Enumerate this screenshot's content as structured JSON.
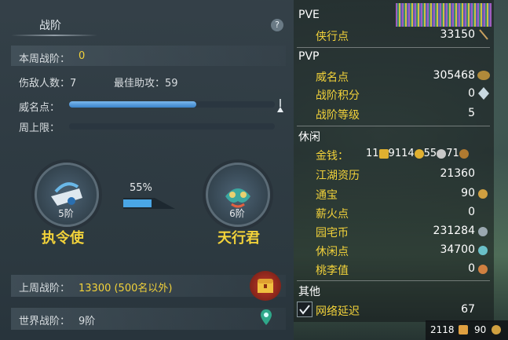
{
  "rank_panel": {
    "title": "战阶",
    "help": "?",
    "weekly_label": "本周战阶：",
    "weekly_value": "0",
    "injured_label": "伤敌人数：",
    "injured_value": "7",
    "best_assist_label": "最佳助攻：",
    "best_assist_value": "59",
    "reputation_label": "威名点：",
    "reputation_fill": 0.62,
    "weekly_cap_label": "周上限：",
    "weekly_cap_fill": 0,
    "progress_percent": "55%",
    "progress_fill": 0.55,
    "current_tier": "5阶",
    "current_name": "执令使",
    "next_tier": "6阶",
    "next_name": "天行君",
    "last_week_label": "上周战阶：",
    "last_week_value": "13300 (500名以外)",
    "world_label": "世界战阶：",
    "world_value": "9阶"
  },
  "stats_panel": {
    "pve_title": "PVE",
    "pve_items": [
      {
        "label": "侠行点",
        "value": "33150"
      }
    ],
    "pvp_title": "PVP",
    "pvp_items": [
      {
        "label": "威名点",
        "value": "305468"
      },
      {
        "label": "战阶积分",
        "value": "0"
      },
      {
        "label": "战阶等级",
        "value": "5"
      }
    ],
    "leisure_title": "休闲",
    "money_label": "金钱：",
    "money": {
      "gold_a": "11",
      "gold_b": "9114",
      "silver": "55",
      "copper": "71"
    },
    "leisure_items": [
      {
        "label": "江湖资历",
        "value": "21360"
      },
      {
        "label": "通宝",
        "value": "90"
      },
      {
        "label": "薪火点",
        "value": "0"
      },
      {
        "label": "园宅币",
        "value": "231284"
      },
      {
        "label": "休闲点",
        "value": "34700"
      },
      {
        "label": "桃李值",
        "value": "0"
      }
    ],
    "other_title": "其他",
    "network_label": "网络延迟",
    "network_value": "67"
  },
  "bottom_bar": {
    "value_a": "2118",
    "value_b": "90"
  },
  "colors": {
    "accent_yellow": "#f2d23a",
    "bar_blue": "#3a82c8"
  }
}
